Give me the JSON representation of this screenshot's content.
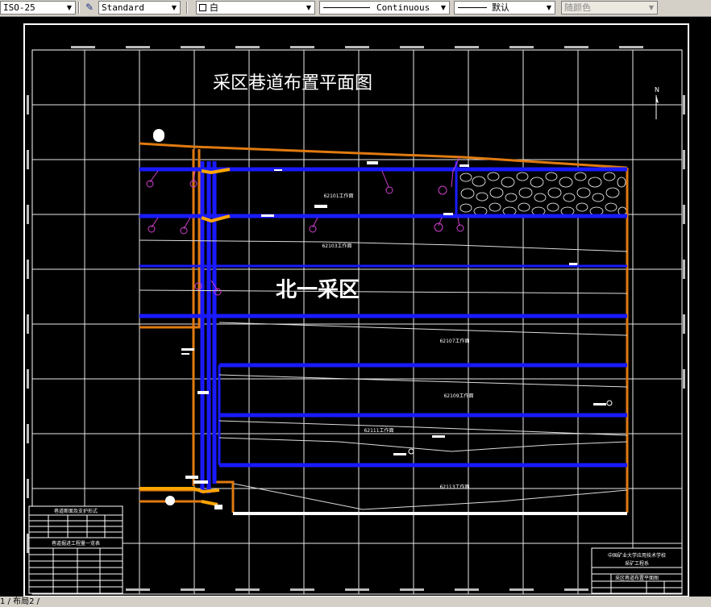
{
  "toolbar": {
    "dimstyle": "ISO-25",
    "textstyle": "Standard",
    "color": "白",
    "linetype": "Continuous",
    "lineweight": "默认",
    "plotstyle": "随颜色"
  },
  "drawing": {
    "title": "采区巷道布置平面图",
    "area_label": "北一采区",
    "north": "N",
    "faces": [
      "62101工作面",
      "62103工作面",
      "62107工作面",
      "62109工作面",
      "62111工作面",
      "62113工作面"
    ],
    "titleblock": {
      "line1": "中国矿业大学应用技术学校",
      "line2": "采矿工程系",
      "line3": "采区巷道布置平面图"
    },
    "legend": {
      "header1": "巷道断面及支护形式",
      "header2": "巷道掘进工程量一览表"
    }
  },
  "status": {
    "tabs": "1 / 布局2 /"
  }
}
